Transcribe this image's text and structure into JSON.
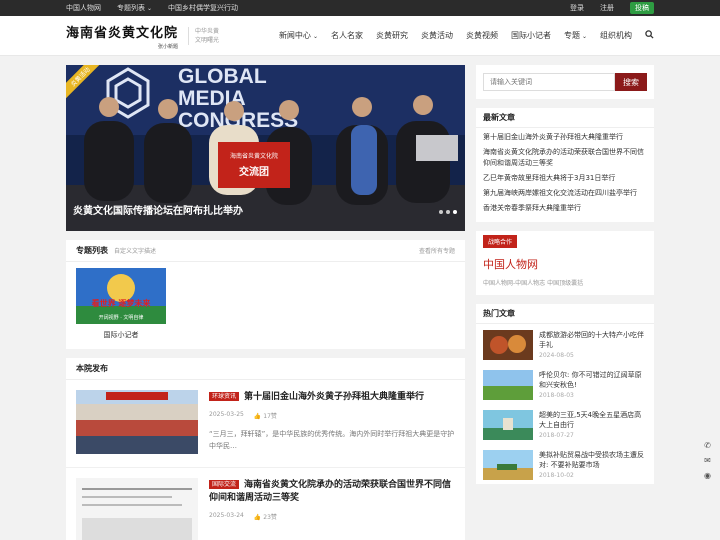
{
  "topbar": {
    "links": [
      "中国人物网",
      "专题列表",
      "中国乡村偶学复兴行动"
    ],
    "login": "登录",
    "register": "注册",
    "contribute": "投稿"
  },
  "header": {
    "logo": "海南省炎黄文化院",
    "logo_sub": "张小新题",
    "slogan": [
      "中华炎黄",
      "文明曙光"
    ],
    "nav": [
      "新闻中心",
      "名人名家",
      "炎黄研究",
      "炎黄活动",
      "炎黄视频",
      "国际小记者",
      "专题",
      "组织机构"
    ]
  },
  "slider": {
    "badge": "炎黄活动",
    "banner_text": [
      "GLOBAL",
      "MEDIA",
      "CONGRESS"
    ],
    "sign_text": [
      "海南省炎黄文化院",
      "交流团"
    ],
    "caption": "炎黄文化国际传播论坛在阿布扎比举办"
  },
  "topics": {
    "title": "专题列表",
    "desc": "自定义文字描述",
    "more": "查看所有专题",
    "thumb_text": "看世界 逐梦未来",
    "thumb_sub": "开阔视野 · 文明自律",
    "items": [
      "国际小记者"
    ]
  },
  "releases": {
    "title": "本院发布",
    "articles": [
      {
        "category": "环球资讯",
        "title": "第十届旧金山海外炎黄子孙拜祖大典隆重举行",
        "date": "2025-03-25",
        "likes": "17赞",
        "excerpt": "“三月三，拜轩辕”，是中华民族的优秀传统。海内外同时举行拜祖大典更是守护中华民…"
      },
      {
        "category": "国际交流",
        "title": "海南省炎黄文化院承办的活动荣获联合国世界不同信仰间和谐周活动三等奖",
        "date": "2025-03-24",
        "likes": "23赞",
        "excerpt": ""
      }
    ]
  },
  "sidebar": {
    "search_placeholder": "请输入关键词",
    "search_button": "搜索",
    "latest_title": "最新文章",
    "latest": [
      "第十届旧金山海外炎黄子孙拜祖大典隆重举行",
      "海南省炎黄文化院承办的活动荣获联合国世界不同信仰间和谐周活动三等奖",
      "乙巳年黄帝故里拜祖大典将于3月31日举行",
      "第九届海峡两岸嫘祖文化交流活动在四川盐亭举行",
      "香港关帝春季祭拜大典隆重举行"
    ],
    "strategy": {
      "tag": "战略合作",
      "name": "中国人物网",
      "sub": "中国人物网-中国人物志 中国顶级囊括"
    },
    "hot_title": "热门文章",
    "hot": [
      {
        "title": "成都旅游必带回的十大特产小吃伴手礼",
        "date": "2024-08-05"
      },
      {
        "title": "呼伦贝尔: 你不可错过的辽阔草原和兴安秋色!",
        "date": "2018-08-03"
      },
      {
        "title": "超美的三亚,5天4晚全五星酒店高大上自由行",
        "date": "2018-07-27"
      },
      {
        "title": "美拟补贴贸易战中受损农场主遭反对: 不要补贴要市场",
        "date": "2018-10-02"
      }
    ]
  },
  "colors": {
    "accent": "#c2231a",
    "search_button": "#8b1a1a",
    "contribute": "#2e9c42",
    "topbar": "#2b2b2b"
  }
}
